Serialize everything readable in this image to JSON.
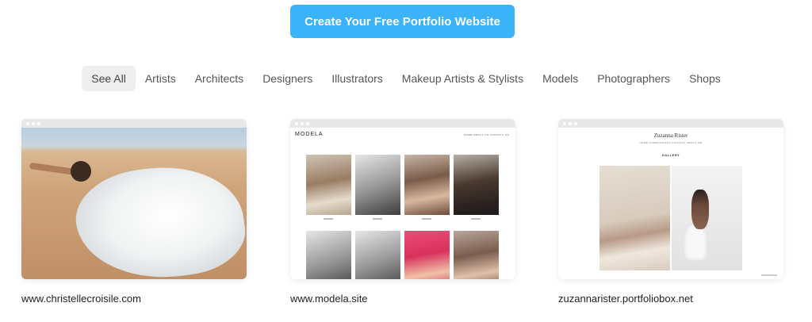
{
  "cta": {
    "label": "Create Your Free Portfolio Website",
    "color": "#3ab3f8"
  },
  "filters": [
    {
      "label": "See All",
      "active": true
    },
    {
      "label": "Artists",
      "active": false
    },
    {
      "label": "Architects",
      "active": false
    },
    {
      "label": "Designers",
      "active": false
    },
    {
      "label": "Illustrators",
      "active": false
    },
    {
      "label": "Makeup Artists & Stylists",
      "active": false
    },
    {
      "label": "Models",
      "active": false
    },
    {
      "label": "Photographers",
      "active": false
    },
    {
      "label": "Shops",
      "active": false
    }
  ],
  "cards": [
    {
      "url": "www.christellecroisile.com",
      "preview": "beach-photo"
    },
    {
      "url": "www.modela.site",
      "preview": "modela-site",
      "logo": "MODELA",
      "nav": "HOME ABOUT US CONTACT US"
    },
    {
      "url": "zuzannarister.portfoliobox.net",
      "preview": "zuzanna-site",
      "title": "Zuzanna Rister",
      "nav": "HOME   COMMISSIONS   CONTACT   ABOUT ME",
      "section": "GALLERY"
    }
  ]
}
